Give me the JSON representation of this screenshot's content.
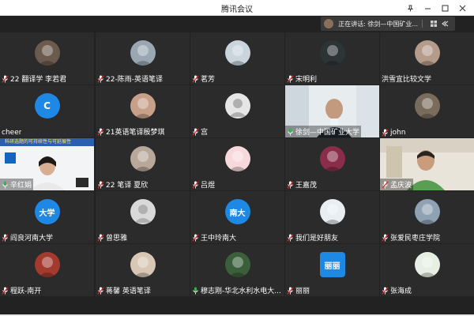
{
  "window": {
    "title": "腾讯会议"
  },
  "speaker_bar": {
    "text": "正在讲话: 徐剑—中国矿业..."
  },
  "colors": {
    "background": "#222222",
    "tile": "#2b2b2b",
    "mic_muted": "#e03131",
    "mic_active": "#37b24d",
    "avatar_blue": "#1e88e5"
  },
  "participants": [
    {
      "name": "22 翻译学 李若君",
      "avatar_text": "",
      "muted": true
    },
    {
      "name": "22-陈雨-英语笔译",
      "avatar_text": "",
      "muted": true
    },
    {
      "name": "茗芳",
      "avatar_text": "",
      "muted": true
    },
    {
      "name": "宋明利",
      "avatar_text": "",
      "muted": true
    },
    {
      "name": "洪雪宜比较文学",
      "avatar_text": "",
      "muted": false
    },
    {
      "name": "cheer",
      "avatar_text": "C",
      "muted": false
    },
    {
      "name": "21英语笔译殷梦琪",
      "avatar_text": "",
      "muted": true
    },
    {
      "name": "宫",
      "avatar_text": "",
      "muted": true
    },
    {
      "name": "徐剑—中国矿业大学",
      "avatar_text": "",
      "muted": false
    },
    {
      "name": "john",
      "avatar_text": "",
      "muted": true
    },
    {
      "name": "辛红娟",
      "avatar_text": "",
      "muted": false,
      "banner": "科研选题的可持续性与可延展性"
    },
    {
      "name": "22 笔译 夏欣",
      "avatar_text": "",
      "muted": true
    },
    {
      "name": "吕煜",
      "avatar_text": "",
      "muted": true
    },
    {
      "name": "王嘉茂",
      "avatar_text": "",
      "muted": true
    },
    {
      "name": "孟庆波",
      "avatar_text": "",
      "muted": true
    },
    {
      "name": "阎良河南大学",
      "avatar_text": "大学",
      "muted": true
    },
    {
      "name": "曾思雅",
      "avatar_text": "",
      "muted": true
    },
    {
      "name": "王中玲南大",
      "avatar_text": "南大",
      "muted": true
    },
    {
      "name": "我们是好朋友",
      "avatar_text": "",
      "muted": true
    },
    {
      "name": "张爱民枣庄学院",
      "avatar_text": "",
      "muted": true
    },
    {
      "name": "程跃-南开",
      "avatar_text": "",
      "muted": true
    },
    {
      "name": "蒋馨 英语笔译",
      "avatar_text": "",
      "muted": true
    },
    {
      "name": "穆志刚-华北水利水电大...",
      "avatar_text": "",
      "muted": false
    },
    {
      "name": "丽丽",
      "avatar_text": "丽丽",
      "muted": true
    },
    {
      "name": "张海成",
      "avatar_text": "",
      "muted": true
    }
  ]
}
